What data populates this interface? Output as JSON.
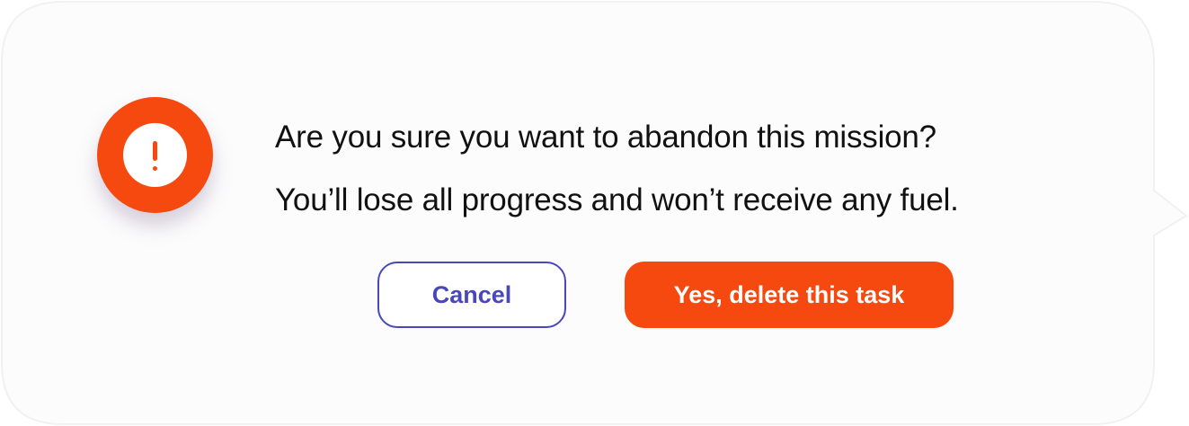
{
  "dialog": {
    "message_line1": "Are you sure you want to abandon this mission?",
    "message_line2": "You’ll lose all progress and won’t receive any fuel.",
    "icon": "exclamation-alert-icon",
    "cancel_label": "Cancel",
    "confirm_label": "Yes, delete this task"
  },
  "colors": {
    "accent": "#f5490f",
    "secondary": "#4a48b8",
    "text": "#111111",
    "background": "#fcfcfc"
  }
}
